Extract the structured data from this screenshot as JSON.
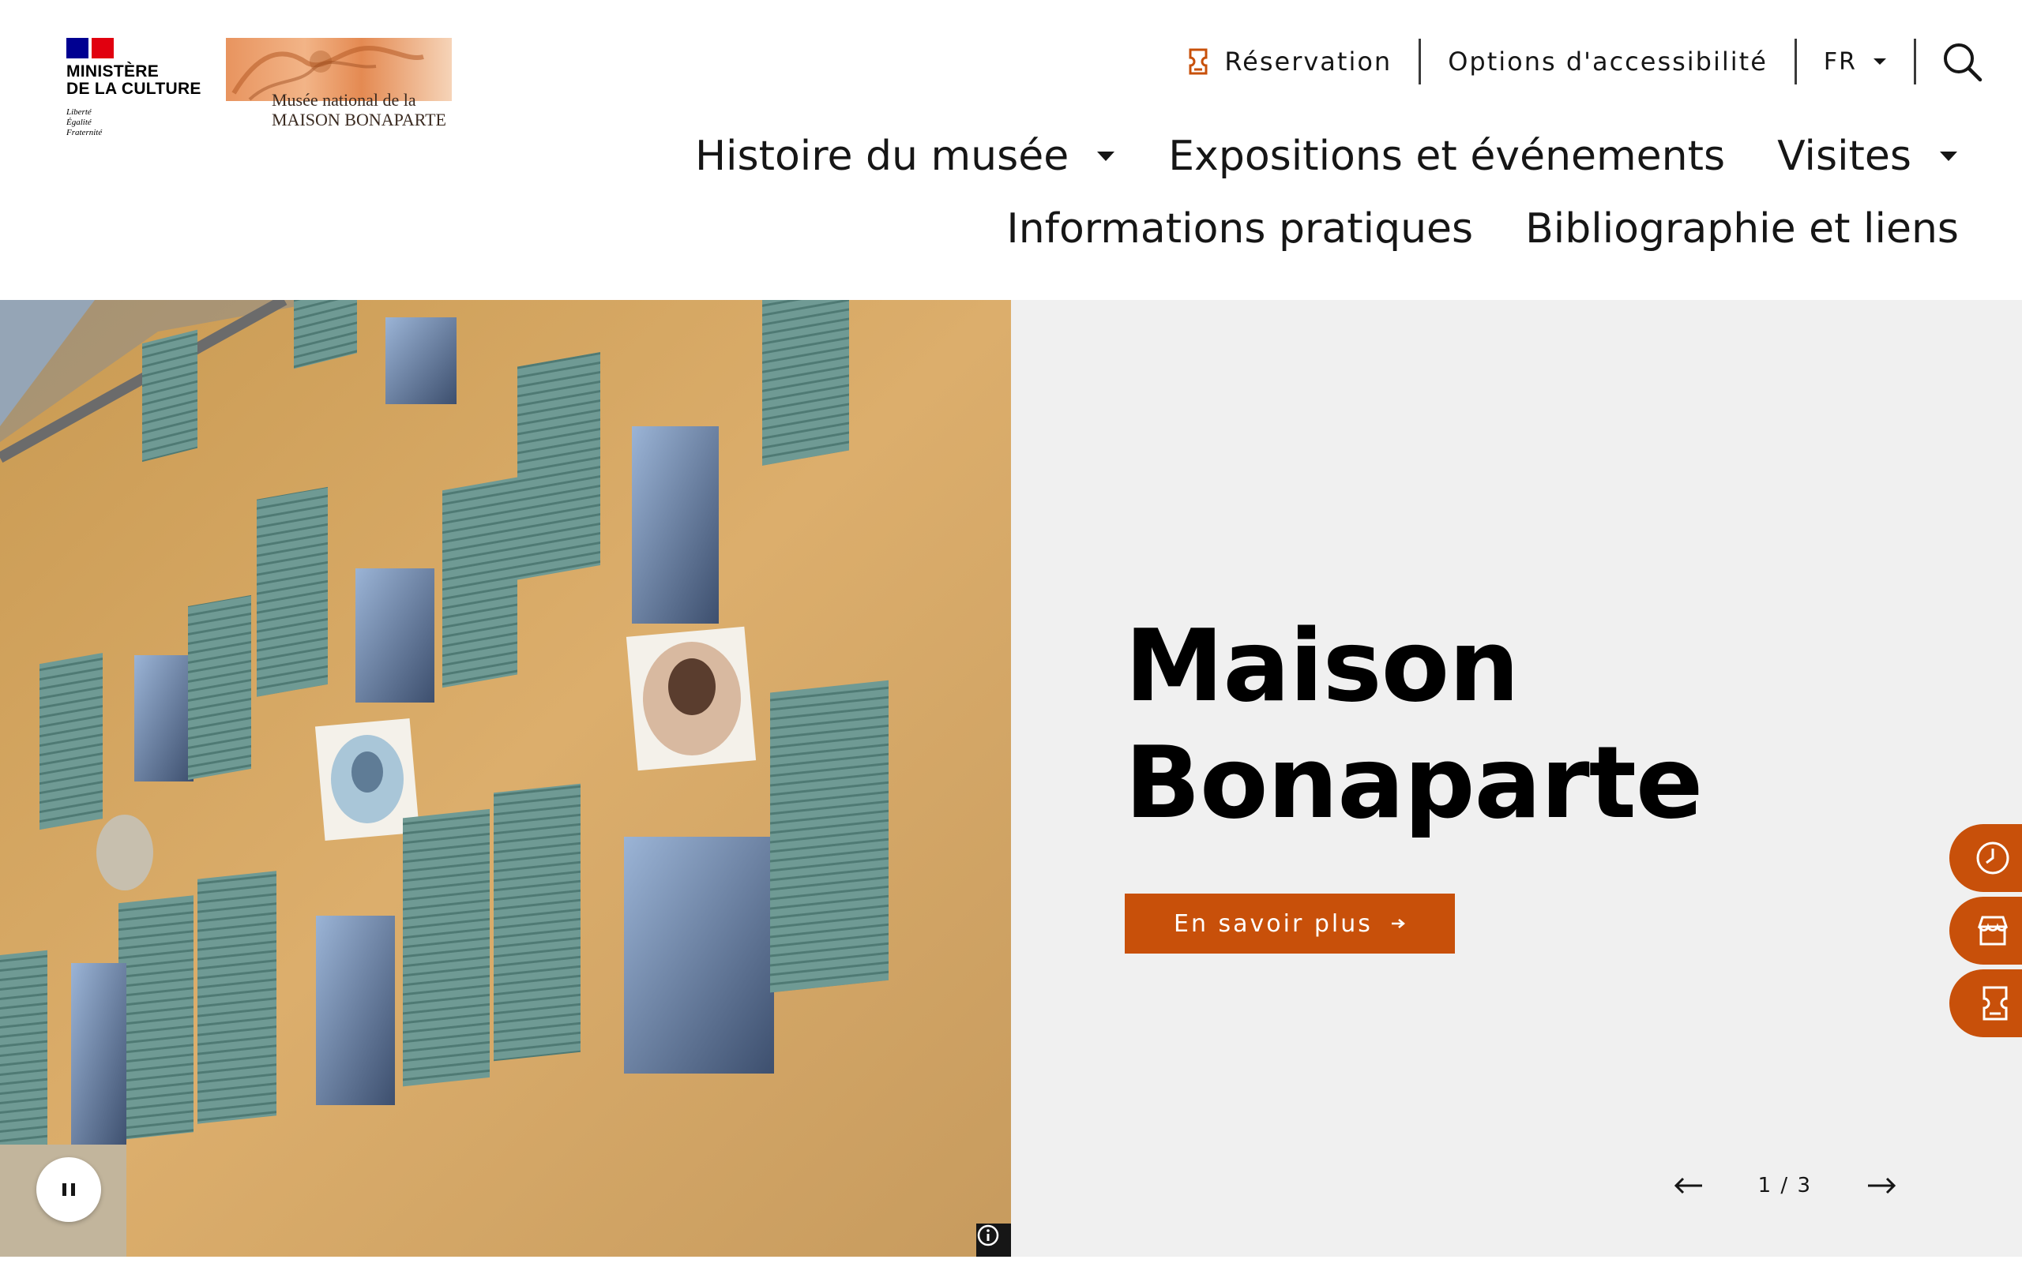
{
  "colors": {
    "accent": "#c8500a",
    "text": "#161616",
    "hero_bg": "#f0f0f0",
    "facade": "#d9a964",
    "shutter": "#6f9a94",
    "ministere_blue": "#000091",
    "ministere_red": "#e1000f"
  },
  "logos": {
    "ministere": {
      "title": "MINISTÈRE\nDE LA CULTURE",
      "motto": "Liberté\nÉgalité\nFraternité"
    },
    "musee": {
      "text": "Musée national de la\nMAISON BONAPARTE"
    }
  },
  "top_links": {
    "reservation": {
      "label": "Réservation",
      "icon": "ticket-icon"
    },
    "accessibility": {
      "label": "Options d'accessibilité"
    },
    "language": {
      "selected": "FR",
      "icon": "chevron-down-icon"
    },
    "search": {
      "icon": "search-icon"
    }
  },
  "nav": {
    "row1": [
      {
        "label": "Histoire du musée",
        "has_dropdown": true
      },
      {
        "label": "Expositions et événements",
        "has_dropdown": false
      },
      {
        "label": "Visites",
        "has_dropdown": true
      }
    ],
    "row2": [
      {
        "label": "Informations pratiques",
        "has_dropdown": false
      },
      {
        "label": "Bibliographie et liens",
        "has_dropdown": false
      }
    ]
  },
  "hero": {
    "title": "Maison\nBonaparte",
    "cta_label": "En savoir plus",
    "cta_icon": "arrow-right-icon",
    "pause_icon": "pause-icon",
    "info_icon": "info-icon",
    "slider": {
      "current": 1,
      "total": 3,
      "counter": "1 / 3",
      "prev_icon": "arrow-left-icon",
      "next_icon": "arrow-right-icon"
    }
  },
  "side_tabs": [
    {
      "icon": "clock-icon"
    },
    {
      "icon": "shop-icon"
    },
    {
      "icon": "ticket-icon"
    }
  ]
}
